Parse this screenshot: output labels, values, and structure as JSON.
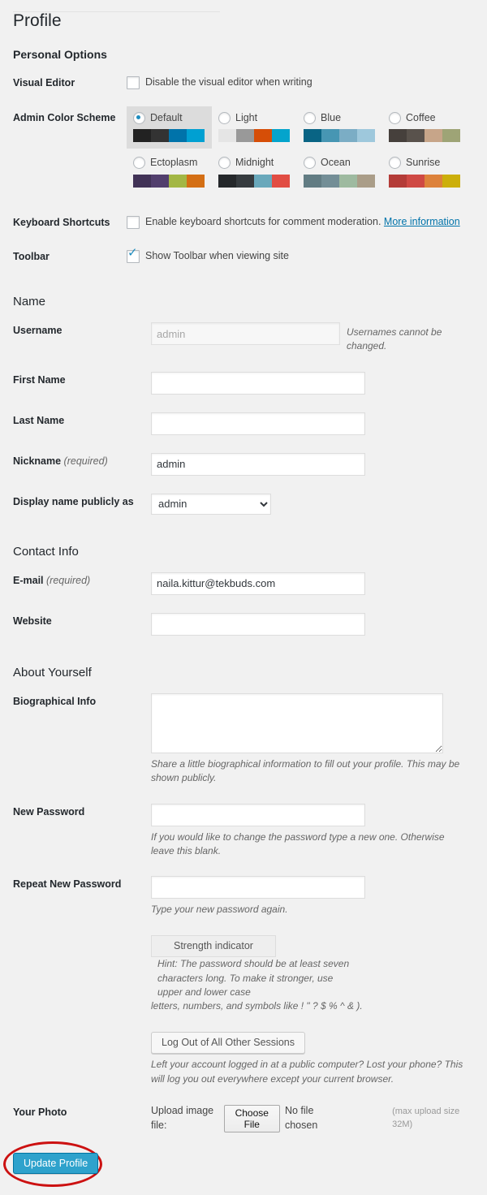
{
  "page": {
    "title": "Profile",
    "personal_options_heading": "Personal Options",
    "name_heading": "Name",
    "contact_heading": "Contact Info",
    "about_heading": "About Yourself"
  },
  "visual_editor": {
    "label": "Visual Editor",
    "checkbox_label": "Disable the visual editor when writing",
    "checked": false
  },
  "admin_color_scheme": {
    "label": "Admin Color Scheme",
    "selected": "Default",
    "schemes": [
      {
        "name": "Default",
        "selected": true,
        "colors": [
          "#222222",
          "#333333",
          "#0073aa",
          "#00a0d2"
        ]
      },
      {
        "name": "Light",
        "selected": false,
        "colors": [
          "#e5e5e5",
          "#999999",
          "#d64e07",
          "#04a4cc"
        ]
      },
      {
        "name": "Blue",
        "selected": false,
        "colors": [
          "#096484",
          "#4796b3",
          "#7badc5",
          "#9ec8dc"
        ]
      },
      {
        "name": "Coffee",
        "selected": false,
        "colors": [
          "#46403c",
          "#59524c",
          "#c7a589",
          "#9ea476"
        ]
      },
      {
        "name": "Ectoplasm",
        "selected": false,
        "colors": [
          "#413256",
          "#523f6d",
          "#a3b745",
          "#d46f15"
        ]
      },
      {
        "name": "Midnight",
        "selected": false,
        "colors": [
          "#25282b",
          "#363b3f",
          "#69a8bb",
          "#e14d43"
        ]
      },
      {
        "name": "Ocean",
        "selected": false,
        "colors": [
          "#627c83",
          "#738e96",
          "#9ebaa0",
          "#aa9d88"
        ]
      },
      {
        "name": "Sunrise",
        "selected": false,
        "colors": [
          "#b43c38",
          "#cf4944",
          "#dd823b",
          "#ccaf0b"
        ]
      }
    ]
  },
  "keyboard_shortcuts": {
    "label": "Keyboard Shortcuts",
    "checkbox_label": "Enable keyboard shortcuts for comment moderation.",
    "link_label": "More information",
    "checked": false
  },
  "toolbar": {
    "label": "Toolbar",
    "checkbox_label": "Show Toolbar when viewing site",
    "checked": true
  },
  "username": {
    "label": "Username",
    "value": "admin",
    "description": "Usernames cannot be changed."
  },
  "first_name": {
    "label": "First Name",
    "value": ""
  },
  "last_name": {
    "label": "Last Name",
    "value": ""
  },
  "nickname": {
    "label": "Nickname",
    "required_note": "(required)",
    "value": "admin"
  },
  "display_name": {
    "label": "Display name publicly as",
    "value": "admin",
    "options": [
      "admin"
    ]
  },
  "email": {
    "label": "E-mail",
    "required_note": "(required)",
    "value": "naila.kittur@tekbuds.com"
  },
  "website": {
    "label": "Website",
    "value": ""
  },
  "biographical_info": {
    "label": "Biographical Info",
    "value": "",
    "description": "Share a little biographical information to fill out your profile. This may be shown publicly."
  },
  "new_password": {
    "label": "New Password",
    "value": "",
    "description": "If you would like to change the password type a new one. Otherwise leave this blank."
  },
  "repeat_password": {
    "label": "Repeat New Password",
    "value": "",
    "description": "Type your new password again."
  },
  "strength": {
    "indicator_label": "Strength indicator",
    "hint_main": "Hint: The password should be at least seven characters long. To make it stronger, use upper and lower case",
    "hint_tail": "letters, numbers, and symbols like ! \" ? $ % ^ & )."
  },
  "sessions": {
    "button_label": "Log Out of All Other Sessions",
    "description": "Left your account logged in at a public computer? Lost your phone? This will log you out everywhere except your current browser."
  },
  "your_photo": {
    "label": "Your Photo",
    "upload_label": "Upload image file:",
    "file_button_label": "Choose File",
    "file_status": "No file chosen",
    "max_size_note": "(max upload size 32M)"
  },
  "submit": {
    "label": "Update Profile",
    "accent_color": "#2ea2cc",
    "annotation_color": "#cc1111"
  }
}
